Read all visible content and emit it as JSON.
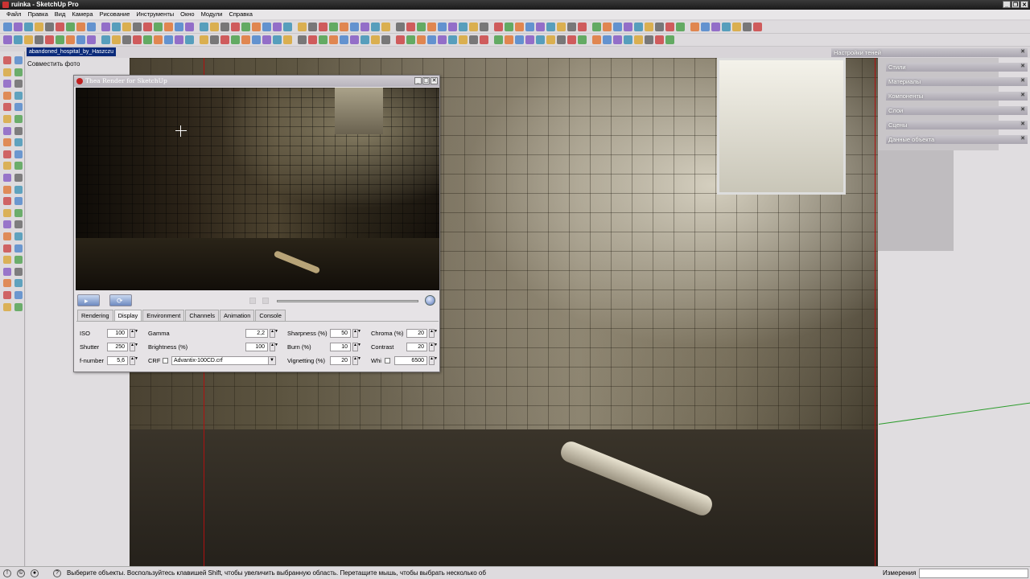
{
  "window": {
    "title": "ruinka - SketchUp Pro"
  },
  "menu": [
    "Файл",
    "Правка",
    "Вид",
    "Камера",
    "Рисование",
    "Инструменты",
    "Окно",
    "Модули",
    "Справка"
  ],
  "scene_tab": "abandoned_hospital_by_Haszczu",
  "photo_match_label": "Совместить фото",
  "tray": {
    "panels": [
      "Настройки теней",
      "Стили",
      "Материалы",
      "Компоненты",
      "Слои",
      "Сцены",
      "Данные объекта"
    ]
  },
  "thea": {
    "title": "Thea Render for SketchUp",
    "tabs": [
      "Rendering",
      "Display",
      "Environment",
      "Channels",
      "Animation",
      "Console"
    ],
    "active_tab": "Display",
    "display": {
      "iso": {
        "label": "ISO",
        "value": "100"
      },
      "shutter": {
        "label": "Shutter",
        "value": "250"
      },
      "fnumber": {
        "label": "f-number",
        "value": "5,6"
      },
      "gamma": {
        "label": "Gamma",
        "value": "2,2"
      },
      "brightness": {
        "label": "Brightness (%)",
        "value": "100"
      },
      "crf": {
        "label": "CRF",
        "value": "Advantix-100CD.crf",
        "checked": false
      },
      "sharpness": {
        "label": "Sharpness (%)",
        "value": "50"
      },
      "burn": {
        "label": "Burn (%)",
        "value": "10"
      },
      "vignetting": {
        "label": "Vignetting (%)",
        "value": "20"
      },
      "chroma": {
        "label": "Chroma (%)",
        "value": "20"
      },
      "contrast": {
        "label": "Contrast",
        "value": "20"
      },
      "whi": {
        "label": "Whi",
        "value": "6500",
        "checked": false
      }
    }
  },
  "status": {
    "text": "Выберите объекты. Воспользуйтесь клавишей Shift, чтобы увеличить выбранную область. Перетащите мышь, чтобы выбрать несколько об",
    "measurements_label": "Измерения",
    "measurements_value": ""
  }
}
